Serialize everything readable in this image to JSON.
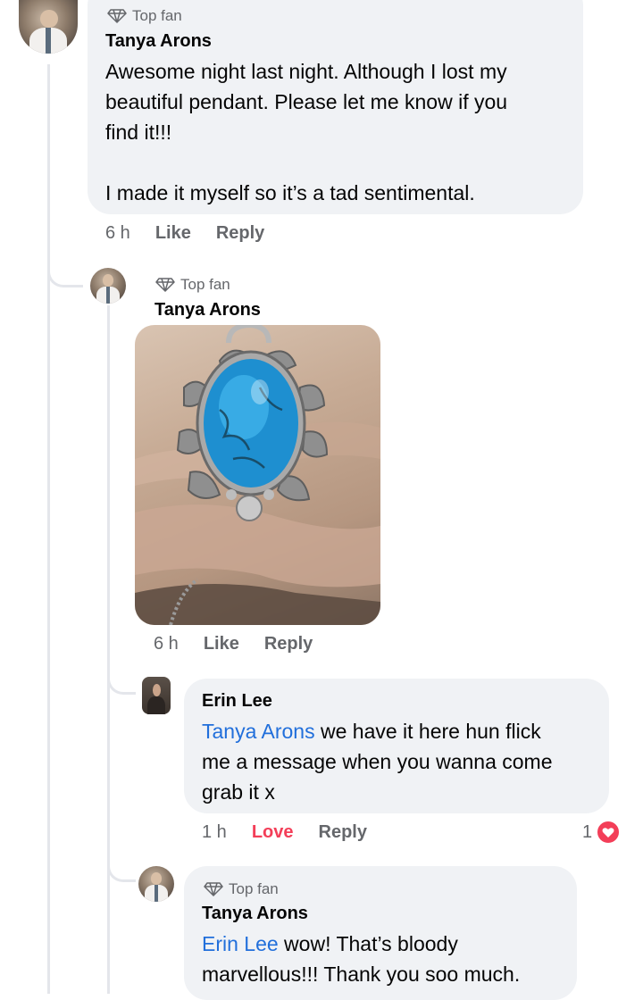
{
  "comments": [
    {
      "badge": "Top fan",
      "author": "Tanya Arons",
      "text_lines": [
        "Awesome night last night. Although I lost my",
        "beautiful pendant.  Please let me know if you",
        "find it!!!",
        "",
        "I made it myself so it’s a tad sentimental."
      ],
      "time": "6 h",
      "like": "Like",
      "reply": "Reply"
    },
    {
      "badge": "Top fan",
      "author": "Tanya Arons",
      "photo_alt": "turquoise pendant in hand",
      "time": "6 h",
      "like": "Like",
      "reply": "Reply"
    },
    {
      "author": "Erin Lee",
      "mention": "Tanya Arons",
      "text_first": " we have it here hun flick",
      "text_lines": [
        "me a message when you wanna come",
        "grab it x"
      ],
      "time": "1 h",
      "love": "Love",
      "reply": "Reply",
      "reaction_count": "1",
      "reaction_icon": "heart-icon",
      "reaction_color": "#f33e58"
    },
    {
      "badge": "Top fan",
      "author": "Tanya Arons",
      "mention": "Erin Lee",
      "text_first": " wow! That’s bloody",
      "text_lines": [
        "marvellous!!! Thank you soo much."
      ]
    }
  ],
  "colors": {
    "bubble": "#f0f2f5",
    "mention": "#216fdb",
    "meta": "#65676b",
    "love": "#f33e58"
  }
}
